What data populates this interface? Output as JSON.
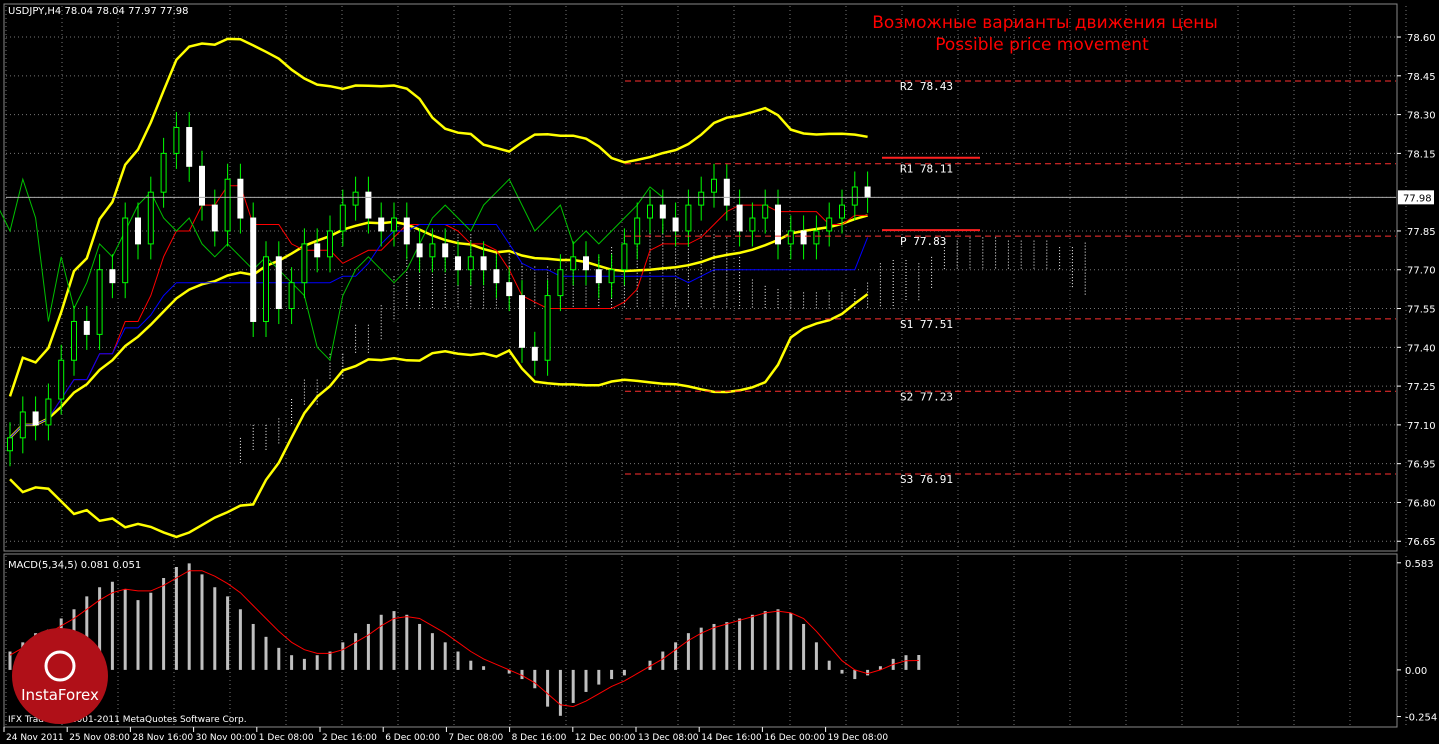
{
  "header": {
    "symbol_info": "USDJPY,H4  78.04 78.04 77.97 77.98"
  },
  "annotation": {
    "line1": "Возможные варианты движения цены",
    "line2": "Possible price movement"
  },
  "colors": {
    "background": "#000000",
    "grid": "#777777",
    "bollinger": "#ffff00",
    "candle_up": "#00ff00",
    "candle_body_down": "#ffffff",
    "kijun": "#0000ff",
    "tenkan": "#ff0000",
    "chikou": "#00c000",
    "kumo_up": "#ffffff",
    "kumo_down": "#d08060",
    "macd_hist": "#c0c0c0",
    "macd_signal": "#ff0000",
    "pivot_line": "#ff3030"
  },
  "chart_data": [
    {
      "type": "candlestick",
      "price_axis": {
        "ticks": [
          "78.60",
          "78.45",
          "78.30",
          "78.15",
          "77.98",
          "77.85",
          "77.70",
          "77.55",
          "77.40",
          "77.25",
          "77.10",
          "76.95",
          "76.80",
          "76.65"
        ],
        "ylim": [
          76.62,
          78.72
        ],
        "current_price": "77.98"
      },
      "time_axis": {
        "labels": [
          "24 Nov 2011",
          "25 Nov 08:00",
          "28 Nov 16:00",
          "30 Nov 00:00",
          "1 Dec 08:00",
          "2 Dec 16:00",
          "6 Dec 00:00",
          "7 Dec 08:00",
          "8 Dec 16:00",
          "12 Dec 00:00",
          "13 Dec 08:00",
          "14 Dec 16:00",
          "16 Dec 00:00",
          "19 Dec 08:00"
        ]
      },
      "levels": [
        {
          "label": "R2 78.43",
          "value": 78.43
        },
        {
          "label": "R1 78.11",
          "value": 78.11
        },
        {
          "label": "P 77.83",
          "value": 77.83
        },
        {
          "label": "S1 77.51",
          "value": 77.51
        },
        {
          "label": "S2 77.23",
          "value": 77.23
        },
        {
          "label": "S3 76.91",
          "value": 76.91
        }
      ],
      "candles_close": [
        77.05,
        77.15,
        77.1,
        77.2,
        77.35,
        77.5,
        77.45,
        77.7,
        77.65,
        77.9,
        77.8,
        78.0,
        78.15,
        78.25,
        78.1,
        77.95,
        77.85,
        78.05,
        77.9,
        77.5,
        77.75,
        77.55,
        77.65,
        77.8,
        77.75,
        77.85,
        77.95,
        78.0,
        77.9,
        77.85,
        77.9,
        77.8,
        77.75,
        77.8,
        77.75,
        77.7,
        77.75,
        77.7,
        77.65,
        77.6,
        77.4,
        77.35,
        77.6,
        77.7,
        77.75,
        77.7,
        77.65,
        77.7,
        77.8,
        77.9,
        77.95,
        77.9,
        77.85,
        77.95,
        78.0,
        78.05,
        77.95,
        77.85,
        77.9,
        77.95,
        77.8,
        77.85,
        77.8,
        77.85,
        77.9,
        77.95,
        78.02,
        77.98
      ]
    },
    {
      "type": "bar",
      "title": "MACD(5,34,5) 0.081 0.051",
      "axis": {
        "ticks": [
          "0.583",
          "0.00",
          "-0.254"
        ],
        "ylim": [
          -0.3,
          0.62
        ]
      },
      "histogram": [
        0.1,
        0.15,
        0.2,
        0.22,
        0.28,
        0.33,
        0.4,
        0.45,
        0.48,
        0.44,
        0.38,
        0.42,
        0.5,
        0.56,
        0.58,
        0.52,
        0.45,
        0.4,
        0.33,
        0.25,
        0.18,
        0.12,
        0.08,
        0.06,
        0.08,
        0.1,
        0.15,
        0.2,
        0.25,
        0.3,
        0.32,
        0.3,
        0.25,
        0.2,
        0.15,
        0.1,
        0.05,
        0.02,
        0.0,
        -0.02,
        -0.05,
        -0.1,
        -0.2,
        -0.25,
        -0.18,
        -0.12,
        -0.08,
        -0.05,
        -0.03,
        0.0,
        0.05,
        0.1,
        0.15,
        0.2,
        0.23,
        0.25,
        0.26,
        0.28,
        0.3,
        0.32,
        0.33,
        0.31,
        0.25,
        0.15,
        0.05,
        -0.02,
        -0.05,
        -0.03,
        0.02,
        0.06,
        0.08,
        0.081
      ],
      "signal": [
        0.08,
        0.12,
        0.16,
        0.2,
        0.24,
        0.28,
        0.33,
        0.38,
        0.42,
        0.44,
        0.43,
        0.43,
        0.46,
        0.5,
        0.54,
        0.54,
        0.51,
        0.47,
        0.42,
        0.35,
        0.28,
        0.21,
        0.15,
        0.11,
        0.09,
        0.09,
        0.11,
        0.15,
        0.19,
        0.24,
        0.28,
        0.29,
        0.28,
        0.24,
        0.2,
        0.15,
        0.1,
        0.06,
        0.03,
        0.0,
        -0.03,
        -0.07,
        -0.13,
        -0.19,
        -0.2,
        -0.17,
        -0.13,
        -0.09,
        -0.06,
        -0.02,
        0.02,
        0.06,
        0.11,
        0.16,
        0.2,
        0.23,
        0.25,
        0.27,
        0.29,
        0.31,
        0.32,
        0.31,
        0.28,
        0.21,
        0.13,
        0.05,
        0.0,
        -0.02,
        0.0,
        0.03,
        0.05,
        0.051
      ]
    }
  ],
  "footer": {
    "copyright": "IFX Trader, © 2001-2011 MetaQuotes Software Corp.",
    "logo_text": "InstaForex"
  }
}
